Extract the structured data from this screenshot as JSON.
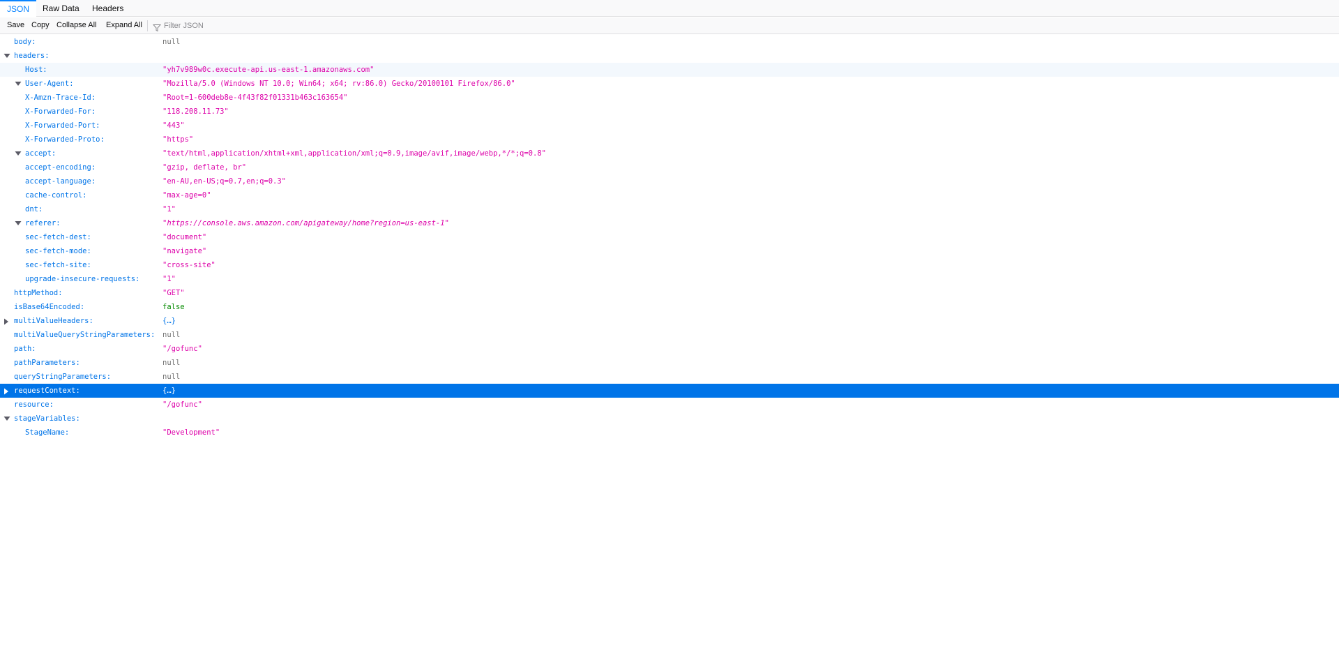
{
  "tabs": [
    {
      "label": "JSON",
      "selected": true
    },
    {
      "label": "Raw Data",
      "selected": false
    },
    {
      "label": "Headers",
      "selected": false
    }
  ],
  "toolbar": {
    "save": "Save",
    "copy": "Copy",
    "collapse_all": "Collapse All",
    "expand_all": "Expand All",
    "filter_placeholder": "Filter JSON",
    "filter_icon": "funnel-icon"
  },
  "colors": {
    "key": "#0074e8",
    "string": "#dd00a9",
    "null": "#737373",
    "boolean": "#058b00",
    "selection": "#0074e8",
    "selected_tab": "#0a84ff"
  },
  "rows": [
    {
      "key": "body:",
      "value": "null",
      "type": "null",
      "depth": 0,
      "twisty": "none"
    },
    {
      "key": "headers:",
      "value": "",
      "type": "none",
      "depth": 0,
      "twisty": "expanded"
    },
    {
      "key": "Host:",
      "value": "\"yh7v989w0c.execute-api.us-east-1.amazonaws.com\"",
      "type": "string",
      "depth": 1,
      "twisty": "none",
      "alt": true
    },
    {
      "key": "User-Agent:",
      "value": "\"Mozilla/5.0 (Windows NT 10.0; Win64; x64; rv:86.0) Gecko/20100101 Firefox/86.0\"",
      "type": "string",
      "depth": 1,
      "twisty": "expanded"
    },
    {
      "key": "X-Amzn-Trace-Id:",
      "value": "\"Root=1-600deb8e-4f43f82f01331b463c163654\"",
      "type": "string",
      "depth": 1,
      "twisty": "none"
    },
    {
      "key": "X-Forwarded-For:",
      "value": "\"118.208.11.73\"",
      "type": "string",
      "depth": 1,
      "twisty": "none"
    },
    {
      "key": "X-Forwarded-Port:",
      "value": "\"443\"",
      "type": "string",
      "depth": 1,
      "twisty": "none"
    },
    {
      "key": "X-Forwarded-Proto:",
      "value": "\"https\"",
      "type": "string",
      "depth": 1,
      "twisty": "none"
    },
    {
      "key": "accept:",
      "value": "\"text/html,application/xhtml+xml,application/xml;q=0.9,image/avif,image/webp,*/*;q=0.8\"",
      "type": "string",
      "depth": 1,
      "twisty": "expanded"
    },
    {
      "key": "accept-encoding:",
      "value": "\"gzip, deflate, br\"",
      "type": "string",
      "depth": 1,
      "twisty": "none"
    },
    {
      "key": "accept-language:",
      "value": "\"en-AU,en-US;q=0.7,en;q=0.3\"",
      "type": "string",
      "depth": 1,
      "twisty": "none"
    },
    {
      "key": "cache-control:",
      "value": "\"max-age=0\"",
      "type": "string",
      "depth": 1,
      "twisty": "none"
    },
    {
      "key": "dnt:",
      "value": "\"1\"",
      "type": "string",
      "depth": 1,
      "twisty": "none"
    },
    {
      "key": "referer:",
      "value": "\"https://console.aws.amazon.com/apigateway/home?region=us-east-1\"",
      "type": "url",
      "depth": 1,
      "twisty": "expanded"
    },
    {
      "key": "sec-fetch-dest:",
      "value": "\"document\"",
      "type": "string",
      "depth": 1,
      "twisty": "none"
    },
    {
      "key": "sec-fetch-mode:",
      "value": "\"navigate\"",
      "type": "string",
      "depth": 1,
      "twisty": "none"
    },
    {
      "key": "sec-fetch-site:",
      "value": "\"cross-site\"",
      "type": "string",
      "depth": 1,
      "twisty": "none"
    },
    {
      "key": "upgrade-insecure-requests:",
      "value": "\"1\"",
      "type": "string",
      "depth": 1,
      "twisty": "none"
    },
    {
      "key": "httpMethod:",
      "value": "\"GET\"",
      "type": "string",
      "depth": 0,
      "twisty": "none"
    },
    {
      "key": "isBase64Encoded:",
      "value": "false",
      "type": "bool",
      "depth": 0,
      "twisty": "none"
    },
    {
      "key": "multiValueHeaders:",
      "value": "{…}",
      "type": "object",
      "depth": 0,
      "twisty": "collapsed"
    },
    {
      "key": "multiValueQueryStringParameters:",
      "value": "null",
      "type": "null",
      "depth": 0,
      "twisty": "none"
    },
    {
      "key": "path:",
      "value": "\"/gofunc\"",
      "type": "string",
      "depth": 0,
      "twisty": "none"
    },
    {
      "key": "pathParameters:",
      "value": "null",
      "type": "null",
      "depth": 0,
      "twisty": "none"
    },
    {
      "key": "queryStringParameters:",
      "value": "null",
      "type": "null",
      "depth": 0,
      "twisty": "none"
    },
    {
      "key": "requestContext:",
      "value": "{…}",
      "type": "object",
      "depth": 0,
      "twisty": "collapsed",
      "selected": true
    },
    {
      "key": "resource:",
      "value": "\"/gofunc\"",
      "type": "string",
      "depth": 0,
      "twisty": "none"
    },
    {
      "key": "stageVariables:",
      "value": "",
      "type": "none",
      "depth": 0,
      "twisty": "expanded"
    },
    {
      "key": "StageName:",
      "value": "\"Development\"",
      "type": "string",
      "depth": 1,
      "twisty": "none"
    }
  ]
}
